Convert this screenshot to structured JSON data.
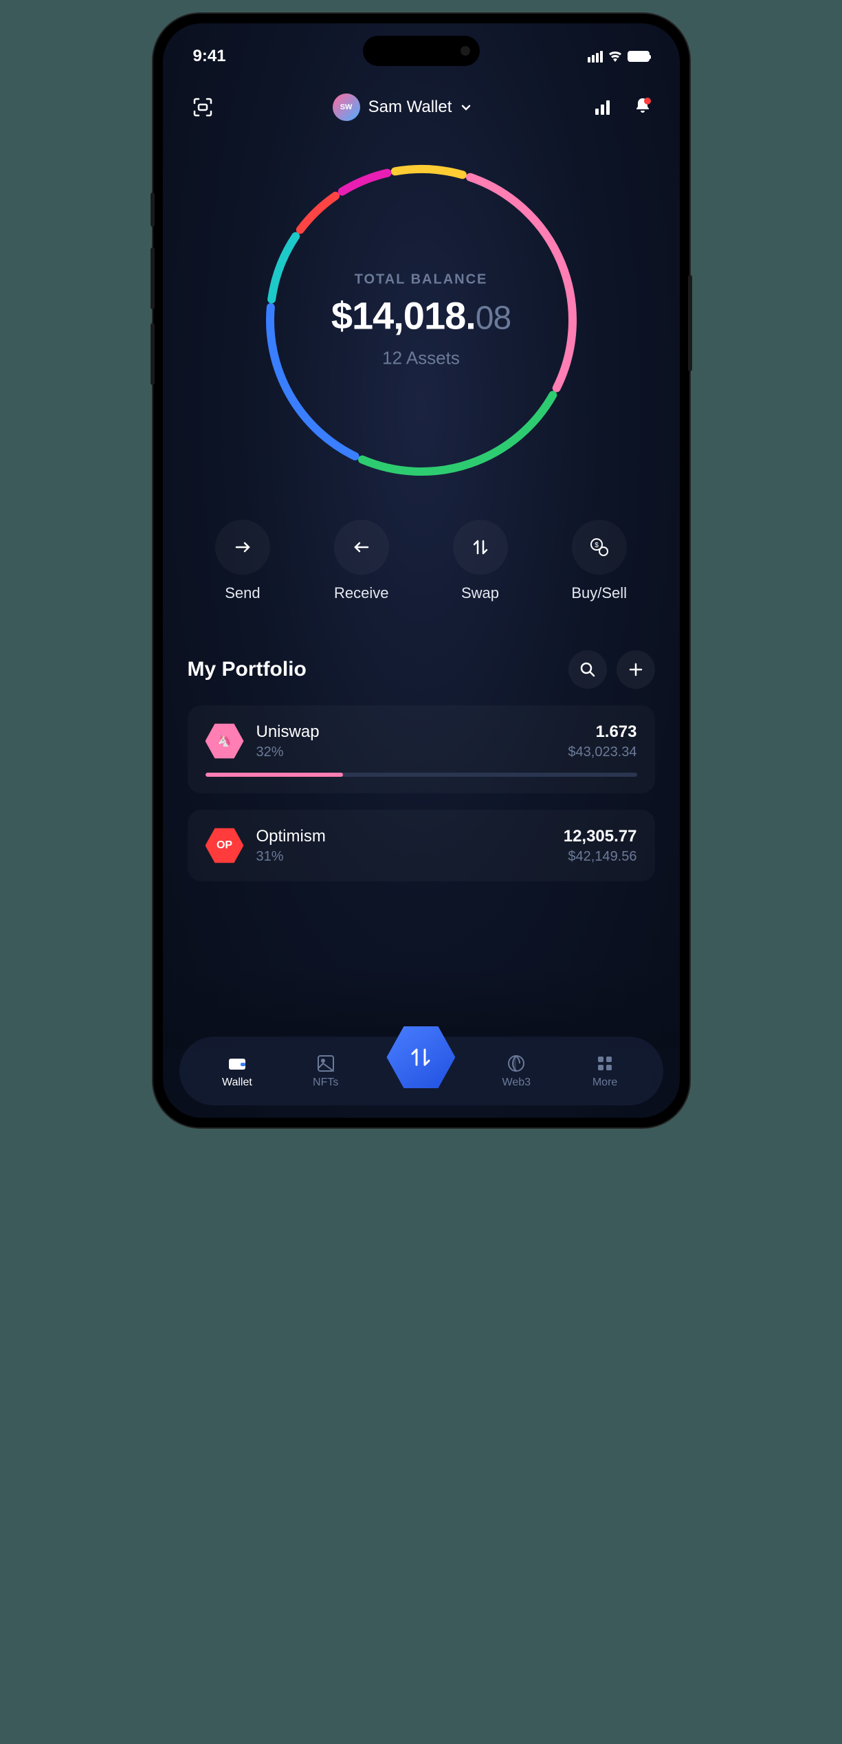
{
  "status": {
    "time": "9:41"
  },
  "header": {
    "wallet_initials": "SW",
    "wallet_name": "Sam Wallet"
  },
  "balance": {
    "label": "TOTAL BALANCE",
    "amount_whole": "$14,018.",
    "amount_cents": "08",
    "assets_text": "12 Assets"
  },
  "actions": {
    "send": "Send",
    "receive": "Receive",
    "swap": "Swap",
    "buysell": "Buy/Sell"
  },
  "portfolio": {
    "title": "My Portfolio",
    "items": [
      {
        "name": "Uniswap",
        "pct": "32%",
        "amount": "1.673",
        "usd": "$43,023.34",
        "bar_pct": 32,
        "color": "#ff7eb3",
        "icon_text": ""
      },
      {
        "name": "Optimism",
        "pct": "31%",
        "amount": "12,305.77",
        "usd": "$42,149.56",
        "bar_pct": 31,
        "color": "#ff3b3b",
        "icon_text": "OP"
      }
    ]
  },
  "bottom_nav": {
    "wallet": "Wallet",
    "nfts": "NFTs",
    "web3": "Web3",
    "more": "More"
  },
  "chart_data": {
    "type": "pie",
    "title": "Portfolio allocation ring",
    "series": [
      {
        "name": "segment-1",
        "value": 8,
        "color": "#ffcc33"
      },
      {
        "name": "segment-2",
        "value": 28,
        "color": "#ff7eb3"
      },
      {
        "name": "segment-3",
        "value": 24,
        "color": "#2ecc71"
      },
      {
        "name": "segment-4",
        "value": 20,
        "color": "#3a7fff"
      },
      {
        "name": "segment-5",
        "value": 8,
        "color": "#1ec9c9"
      },
      {
        "name": "segment-6",
        "value": 6,
        "color": "#ff4444"
      },
      {
        "name": "segment-7",
        "value": 6,
        "color": "#e91eb3"
      }
    ]
  }
}
